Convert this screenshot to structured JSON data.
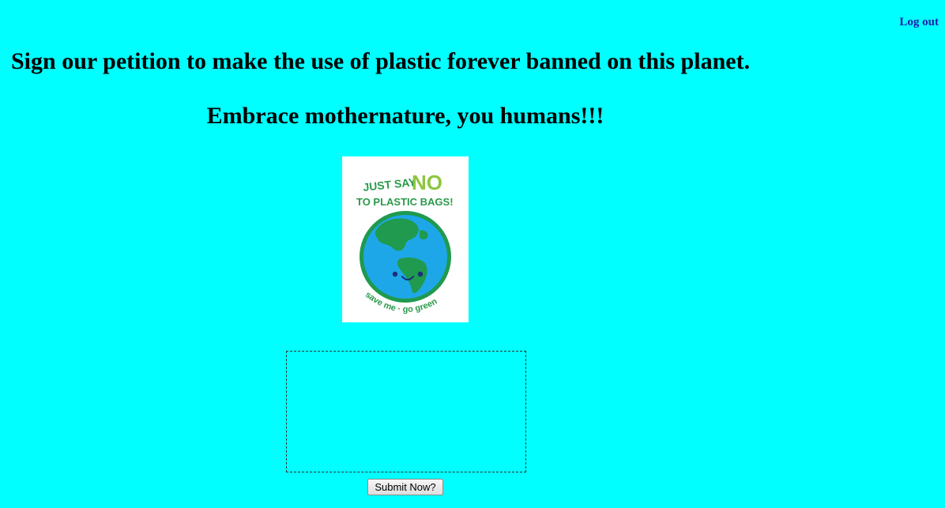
{
  "header": {
    "logout_label": "Log out"
  },
  "main": {
    "headline": "Sign our petition to make the use of plastic forever banned on this planet.",
    "subheadline": "Embrace mothernature, you humans!!!"
  },
  "poster": {
    "line1_prefix": "JUST SAY",
    "line1_emphasis": "NO",
    "line2": "TO PLASTIC BAGS!",
    "footer": "save me · go green",
    "colors": {
      "green": "#2a9a4a",
      "lime": "#8dc63f",
      "ocean": "#1ea7e8",
      "land": "#1f9a4e"
    }
  },
  "form": {
    "textarea_value": "",
    "submit_label": "Submit Now?"
  },
  "colors": {
    "page_background": "#00FFFF",
    "link": "#1e1ea8"
  }
}
